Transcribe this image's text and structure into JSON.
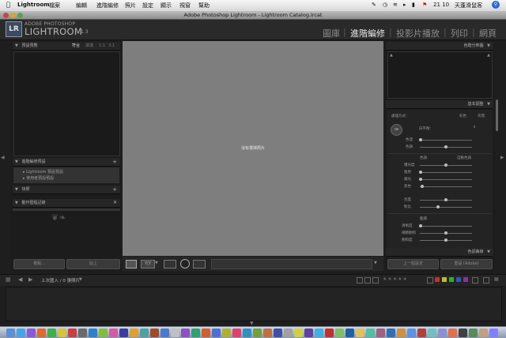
{
  "menubar": {
    "app_name": "Lightroom",
    "items": [
      "檔案",
      "編輯",
      "進階編修",
      "照片",
      "設定",
      "顯示",
      "視窗",
      "幫助"
    ],
    "clock": "21 10",
    "input_method": "天蓬滑鼠客"
  },
  "window": {
    "title": "Adobe Photoshop Lightroom - Lightroom Catalog.lrcat"
  },
  "identity": {
    "logo": "LR",
    "line1": "ADOBE PHOTOSHOP",
    "line2": "LIGHTROOM",
    "version": "1.3"
  },
  "modules": [
    {
      "label": "圖庫",
      "active": false
    },
    {
      "label": "進階編修",
      "active": true
    },
    {
      "label": "投影片播放",
      "active": false
    },
    {
      "label": "列印",
      "active": false
    },
    {
      "label": "網頁",
      "active": false
    }
  ],
  "left_panel": {
    "presets_title": "預設預覽",
    "presets_opts": [
      "符合",
      "填滿",
      "1:1",
      "3:1"
    ],
    "develop_presets_title": "進階編修預設",
    "presets_list": [
      "Lightroom 預設預設",
      "使用者預設預設"
    ],
    "snapshots_title": "快照",
    "history_title": "動作歷程記錄",
    "copy_btn": "複製...",
    "paste_btn": "貼上"
  },
  "center": {
    "message": "沒有選擇照片"
  },
  "right_panel": {
    "histogram_title": "色階分佈圖",
    "basic_title": "基本調整",
    "treatment_label": "處理方式：",
    "treatment_opts": [
      "彩色",
      "灰階"
    ],
    "wb_label": "白平衡：",
    "temp_label": "色溫",
    "tint_label": "色調",
    "tone_label": "色調",
    "auto_label": "自動色調",
    "tone_rows": [
      "曝光度",
      "復原",
      "補光",
      "黑色"
    ],
    "bright_rows": [
      "亮度",
      "對比"
    ],
    "presence_label": "臨場",
    "presence_rows": [
      "清晰度",
      "細節飽和",
      "飽和度"
    ],
    "curve_title": "色調曲線",
    "prev_btn": "上一個設定",
    "reset_btn": "重設 (Adobe)"
  },
  "filmstrip": {
    "source": "上次匯入 / 0 張照片"
  },
  "dock": {
    "colors": [
      "#5b8fd8",
      "#4aa3e8",
      "#8c5ad6",
      "#e06a2c",
      "#3fae4c",
      "#d8c23a",
      "#c84040",
      "#6a6a6a",
      "#2f7fc9",
      "#7fbf3a",
      "#d45aa8",
      "#3c3c9e",
      "#e0a030",
      "#50a0a0",
      "#a04a2a",
      "#4a7ad0",
      "#c0c0c0",
      "#9050c0",
      "#30a070",
      "#d06030",
      "#5070d0",
      "#b0b030",
      "#e04070",
      "#3090c0",
      "#70a040",
      "#c07040",
      "#4050a0",
      "#a0a0a0",
      "#d0d040",
      "#6040a0",
      "#40b0e0",
      "#c03030",
      "#80c060",
      "#2060a0",
      "#e0c060",
      "#50c0a0",
      "#a06080",
      "#3070b0",
      "#d09040",
      "#6090e0",
      "#b04040",
      "#70c0c0",
      "#9090d0",
      "#e07050",
      "#404040",
      "#5a8a5a",
      "#c0a080",
      "#8080ff"
    ]
  }
}
